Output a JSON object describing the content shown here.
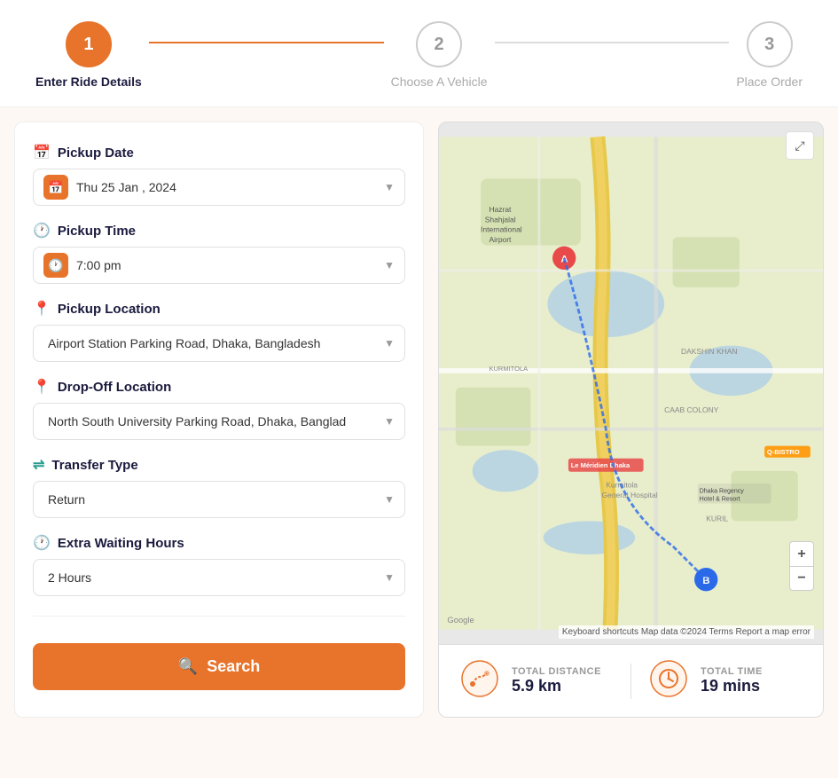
{
  "stepper": {
    "steps": [
      {
        "number": "1",
        "label": "Enter Ride Details",
        "state": "active"
      },
      {
        "number": "2",
        "label": "Choose A Vehicle",
        "state": "inactive"
      },
      {
        "number": "3",
        "label": "Place Order",
        "state": "inactive"
      }
    ]
  },
  "form": {
    "pickup_date": {
      "label": "Pickup Date",
      "value": "Thu 25 Jan , 2024",
      "icon": "calendar"
    },
    "pickup_time": {
      "label": "Pickup Time",
      "value": "7:00 pm",
      "icon": "clock"
    },
    "pickup_location": {
      "label": "Pickup Location",
      "value": "Airport Station Parking Road, Dhaka, Bangladesh",
      "icon": "pin-red"
    },
    "dropoff_location": {
      "label": "Drop-Off Location",
      "value": "North South University Parking Road, Dhaka, Banglad",
      "icon": "pin-red"
    },
    "transfer_type": {
      "label": "Transfer Type",
      "value": "Return",
      "icon": "transfer"
    },
    "extra_waiting": {
      "label": "Extra Waiting Hours",
      "value": "2 Hours",
      "icon": "clock-orange"
    },
    "search_button": "Search"
  },
  "map": {
    "expand_icon": "⤢",
    "zoom_in": "+",
    "zoom_out": "−",
    "attribution": "Keyboard shortcuts   Map data ©2024   Terms   Report a map error",
    "marker_a_label": "A",
    "marker_b_label": "B"
  },
  "stats": {
    "distance_label": "TOTAL DISTANCE",
    "distance_value": "5.9 km",
    "time_label": "TOTAL TIME",
    "time_value": "19 mins"
  }
}
